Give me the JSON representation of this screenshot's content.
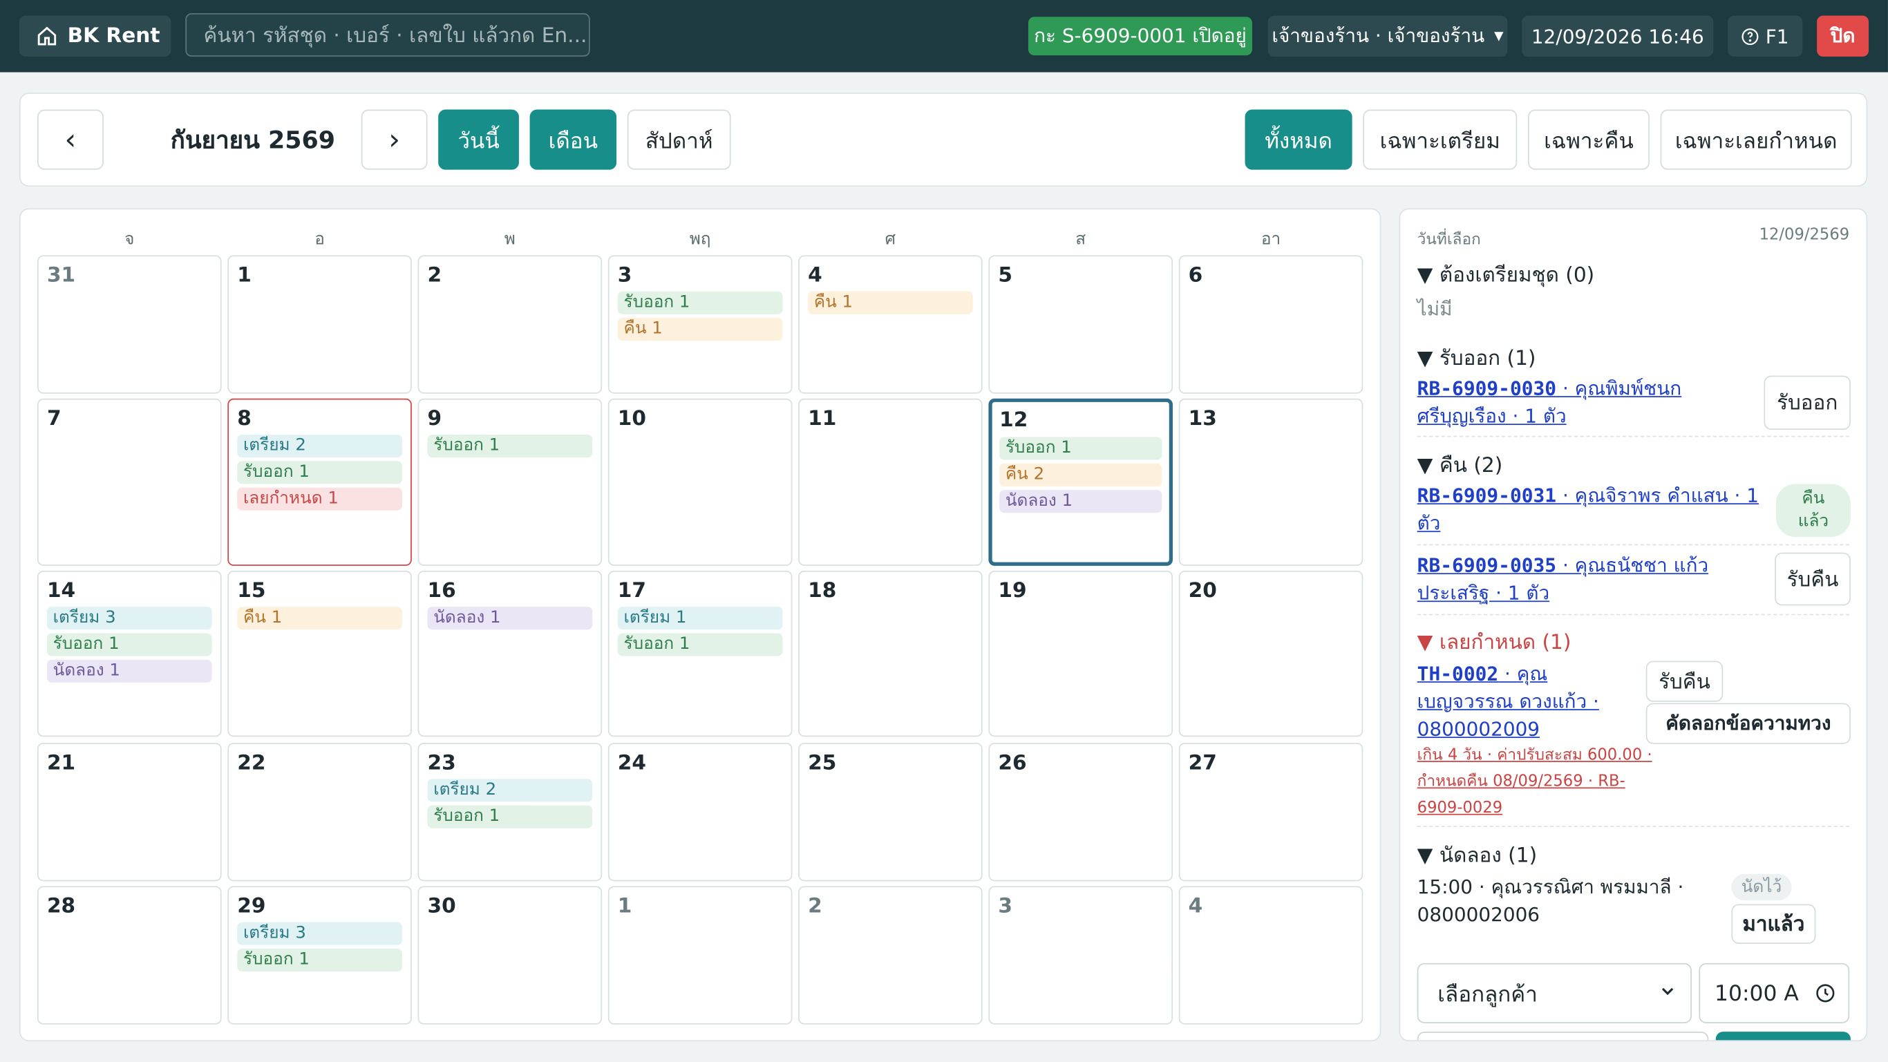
{
  "topbar": {
    "brand": "BK Rent",
    "search_placeholder": "ค้นหา รหัสชุด · เบอร์ · เลขใบ แล้วกด En...",
    "shift": "กะ S-6909-0001 เปิดอยู่",
    "user": "เจ้าของร้าน · เจ้าของร้าน",
    "datetime": "12/09/2026 16:46",
    "help": "F1",
    "close": "ปิด"
  },
  "toolbar": {
    "prev": "‹",
    "month": "กันยายน 2569",
    "next": "›",
    "today": "วันนี้",
    "view_month": "เดือน",
    "view_week": "สัปดาห์",
    "filters": [
      "ทั้งหมด",
      "เฉพาะเตรียม",
      "เฉพาะคืน",
      "เฉพาะเลยกำหนด"
    ]
  },
  "calendar": {
    "weekdays": [
      "จ",
      "อ",
      "พ",
      "พฤ",
      "ศ",
      "ส",
      "อา"
    ],
    "weeks": [
      [
        {
          "day": "31",
          "other": true,
          "chips": []
        },
        {
          "day": "1",
          "chips": []
        },
        {
          "day": "2",
          "chips": []
        },
        {
          "day": "3",
          "chips": [
            {
              "t": "pick",
              "label": "รับออก 1"
            },
            {
              "t": "ret",
              "label": "คืน 1"
            }
          ]
        },
        {
          "day": "4",
          "chips": [
            {
              "t": "ret",
              "label": "คืน 1"
            }
          ]
        },
        {
          "day": "5",
          "chips": []
        },
        {
          "day": "6",
          "chips": []
        }
      ],
      [
        {
          "day": "7",
          "chips": []
        },
        {
          "day": "8",
          "today": true,
          "chips": [
            {
              "t": "prep",
              "label": "เตรียม 2"
            },
            {
              "t": "pick",
              "label": "รับออก 1"
            },
            {
              "t": "late",
              "label": "เลยกำหนด 1"
            }
          ]
        },
        {
          "day": "9",
          "chips": [
            {
              "t": "pick",
              "label": "รับออก 1"
            }
          ]
        },
        {
          "day": "10",
          "chips": []
        },
        {
          "day": "11",
          "chips": []
        },
        {
          "day": "12",
          "selected": true,
          "chips": [
            {
              "t": "pick",
              "label": "รับออก 1"
            },
            {
              "t": "ret",
              "label": "คืน 2"
            },
            {
              "t": "fit",
              "label": "นัดลอง 1"
            }
          ]
        },
        {
          "day": "13",
          "chips": []
        }
      ],
      [
        {
          "day": "14",
          "chips": [
            {
              "t": "prep",
              "label": "เตรียม 3"
            },
            {
              "t": "pick",
              "label": "รับออก 1"
            },
            {
              "t": "fit",
              "label": "นัดลอง 1"
            }
          ]
        },
        {
          "day": "15",
          "chips": [
            {
              "t": "ret",
              "label": "คืน 1"
            }
          ]
        },
        {
          "day": "16",
          "chips": [
            {
              "t": "fit",
              "label": "นัดลอง 1"
            }
          ]
        },
        {
          "day": "17",
          "chips": [
            {
              "t": "prep",
              "label": "เตรียม 1"
            },
            {
              "t": "pick",
              "label": "รับออก 1"
            }
          ]
        },
        {
          "day": "18",
          "chips": []
        },
        {
          "day": "19",
          "chips": []
        },
        {
          "day": "20",
          "chips": []
        }
      ],
      [
        {
          "day": "21",
          "chips": []
        },
        {
          "day": "22",
          "chips": []
        },
        {
          "day": "23",
          "chips": [
            {
              "t": "prep",
              "label": "เตรียม 2"
            },
            {
              "t": "pick",
              "label": "รับออก 1"
            }
          ]
        },
        {
          "day": "24",
          "chips": []
        },
        {
          "day": "25",
          "chips": []
        },
        {
          "day": "26",
          "chips": []
        },
        {
          "day": "27",
          "chips": []
        }
      ],
      [
        {
          "day": "28",
          "chips": []
        },
        {
          "day": "29",
          "chips": [
            {
              "t": "prep",
              "label": "เตรียม 3"
            },
            {
              "t": "pick",
              "label": "รับออก 1"
            }
          ]
        },
        {
          "day": "30",
          "chips": []
        },
        {
          "day": "1",
          "other": true,
          "chips": []
        },
        {
          "day": "2",
          "other": true,
          "chips": []
        },
        {
          "day": "3",
          "other": true,
          "chips": []
        },
        {
          "day": "4",
          "other": true,
          "chips": []
        }
      ]
    ]
  },
  "side": {
    "label": "วันที่เลือก",
    "date": "12/09/2569",
    "prep_title": "▼ ต้องเตรียมชุด (0)",
    "prep_none": "ไม่มี",
    "pickup_title": "▼ รับออก (1)",
    "pickup_code": "RB-6909-0030",
    "pickup_rest": " · คุณพิมพ์ชนก",
    "pickup_rest2": "ศรีบุญเรือง · 1 ตัว",
    "pickup_btn": "รับออก",
    "return_title": "▼ คืน (2)",
    "ret1_code": "RB-6909-0031",
    "ret1_rest": " · คุณจิราพร คำแสน · 1",
    "ret1_rest2": "ตัว",
    "ret1_status1": "คืน",
    "ret1_status2": "แล้ว",
    "ret2_code": "RB-6909-0035",
    "ret2_rest": " · คุณธนัชชา แก้ว",
    "ret2_rest2": "ประเสริฐ · 1 ตัว",
    "ret2_btn": "รับคืน",
    "late_title": "▼ เลยกำหนด (1)",
    "late_code": "TH-0002",
    "late_rest": " · คุณ",
    "late_rest2": "เบญจวรรณ ดวงแก้ว ·",
    "late_rest3": "0800002009",
    "late_note": "เกิน 4 วัน · ค่าปรับสะสม 600.00 · กำหนดคืน 08/09/2569 · RB-6909-0029",
    "late_btn1": "รับคืน",
    "late_btn2": "คัดลอกข้อความทวง",
    "fit_title": "▼ นัดลอง (1)",
    "fit_line1": "15:00 · คุณวรรณิศา พรมมาลี ·",
    "fit_line2": "0800002006",
    "fit_tag": "นัดไว้",
    "fit_btn": "มาแล้ว",
    "customer_select": "เลือกลูกค้า",
    "time_value": "10:00 A"
  },
  "colors": {
    "topbar": "#1c3a40",
    "accent": "#178e8a",
    "shift_green": "#2e9a55",
    "danger": "#e24a4a",
    "selected_border": "#2f6d8a"
  }
}
